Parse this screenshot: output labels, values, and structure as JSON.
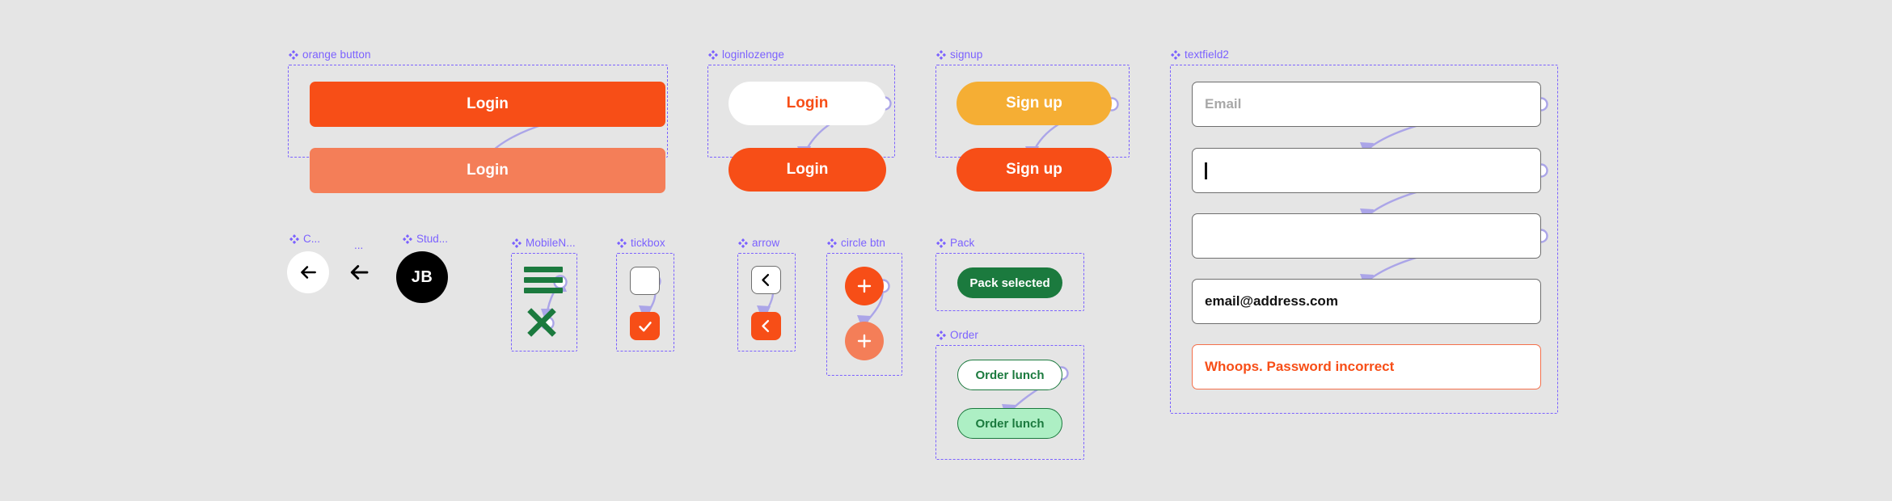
{
  "canvas": {
    "background": "#e5e5e5"
  },
  "palette": {
    "frame_purple": "#7b61ff",
    "connector": "#aba5e8",
    "orange": "#f74e17",
    "orange_pressed": "#f47e58",
    "amber": "#f5ae34",
    "green": "#1b7a3e",
    "mint": "#adefc4",
    "error_border": "#f4704b",
    "field_border": "#6e6e6e",
    "placeholder": "#a8a8a8"
  },
  "groups": {
    "orange_button": {
      "label": "orange button",
      "default_label": "Login",
      "pressed_label": "Login"
    },
    "loginlozenge": {
      "label": "loginlozenge",
      "default_label": "Login",
      "pressed_label": "Login"
    },
    "signup": {
      "label": "signup",
      "default_label": "Sign up",
      "pressed_label": "Sign up"
    },
    "textfield2": {
      "label": "textfield2",
      "field1_placeholder": "Email",
      "field2_value": "",
      "field3_value": "",
      "field4_value": "email@address.com",
      "field5_value": "Whoops. Password incorrect"
    },
    "close_button": {
      "label": "C..."
    },
    "back_arrow": {
      "label": "..."
    },
    "student": {
      "label": "Stud...",
      "initials": "JB"
    },
    "mobile_nav": {
      "label": "MobileN..."
    },
    "tickbox": {
      "label": "tickbox"
    },
    "arrow": {
      "label": "arrow"
    },
    "circle_btn": {
      "label": "circle btn"
    },
    "pack": {
      "label": "Pack",
      "selected_label": "Pack selected"
    },
    "order": {
      "label": "Order",
      "default_label": "Order lunch",
      "pressed_label": "Order lunch"
    }
  }
}
